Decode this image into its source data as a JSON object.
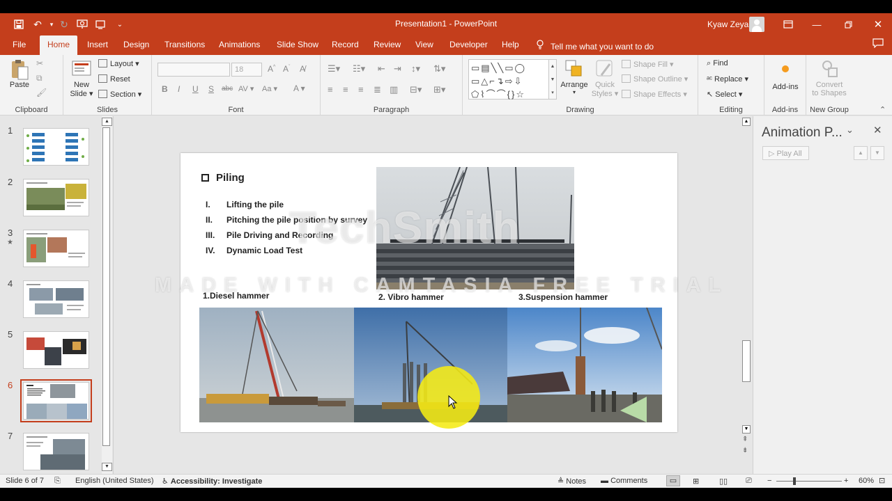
{
  "window": {
    "title": "Presentation1  -  PowerPoint",
    "user": "Kyaw Zeya",
    "accent_color": "#c43e1c"
  },
  "tabs": [
    "File",
    "Home",
    "Insert",
    "Design",
    "Transitions",
    "Animations",
    "Slide Show",
    "Record",
    "Review",
    "View",
    "Developer",
    "Help"
  ],
  "active_tab": "Home",
  "tell_me": "Tell me what you want to do",
  "ribbon": {
    "clipboard": {
      "paste": "Paste",
      "label": "Clipboard"
    },
    "slides": {
      "new_slide_1": "New",
      "new_slide_2": "Slide",
      "layout": "Layout",
      "reset": "Reset",
      "section": "Section",
      "label": "Slides"
    },
    "font": {
      "size": "18",
      "label": "Font"
    },
    "paragraph": {
      "label": "Paragraph"
    },
    "drawing": {
      "arrange": "Arrange",
      "quick_styles_1": "Quick",
      "quick_styles_2": "Styles",
      "shape_fill": "Shape Fill",
      "shape_outline": "Shape Outline",
      "shape_effects": "Shape Effects",
      "label": "Drawing"
    },
    "editing": {
      "find": "Find",
      "replace": "Replace",
      "select": "Select",
      "label": "Editing"
    },
    "addins": {
      "button": "Add-ins",
      "label": "Add-ins"
    },
    "newgroup": {
      "convert_1": "Convert",
      "convert_2": "to Shapes",
      "label": "New Group"
    }
  },
  "thumbnails": [
    {
      "num": "1"
    },
    {
      "num": "2"
    },
    {
      "num": "3"
    },
    {
      "num": "4"
    },
    {
      "num": "5"
    },
    {
      "num": "6"
    },
    {
      "num": "7"
    }
  ],
  "selected_slide": 6,
  "slide": {
    "heading": "Piling",
    "steps": [
      {
        "num": "I.",
        "text": "Lifting the pile"
      },
      {
        "num": "II.",
        "text": "Pitching the pile position by survey"
      },
      {
        "num": "III.",
        "text": "Pile Driving and Recording"
      },
      {
        "num": "IV.",
        "text": "Dynamic Load Test"
      }
    ],
    "captions": [
      "1.Diesel hammer",
      "2. Vibro hammer",
      "3.Suspension hammer"
    ]
  },
  "watermark": {
    "brand": "TechSmith",
    "trial": "MADE WITH CAMTASIA FREE TRIAL"
  },
  "animation_pane": {
    "title": "Animation P...",
    "play_all": "Play All"
  },
  "statusbar": {
    "slide_info": "Slide 6 of 7",
    "language": "English (United States)",
    "accessibility": "Accessibility: Investigate",
    "notes": "Notes",
    "comments": "Comments",
    "zoom": "60%"
  }
}
